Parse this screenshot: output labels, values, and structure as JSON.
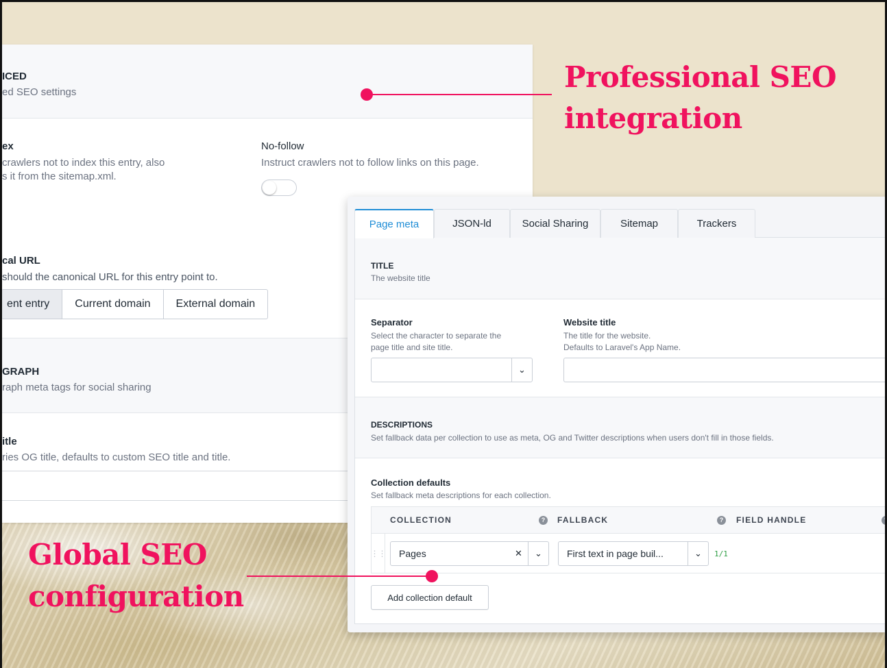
{
  "callouts": {
    "professional_line1": "Professional SEO",
    "professional_line2": "integration",
    "global_line1": "Global SEO",
    "global_line2": "configuration"
  },
  "back_panel": {
    "advanced_title": "ICED",
    "advanced_subtitle": "ed SEO settings",
    "noindex_label": "ex",
    "noindex_desc_line1": "crawlers not to index this entry, also",
    "noindex_desc_line2": "s it from the sitemap.xml.",
    "nofollow_label": "No-follow",
    "nofollow_desc": "Instruct crawlers not to follow links on this page.",
    "canonical_label": "cal URL",
    "canonical_desc": "should the canonical URL for this entry point to.",
    "canonical_options": [
      "ent entry",
      "Current domain",
      "External domain"
    ],
    "og_title": "GRAPH",
    "og_subtitle": "raph meta tags for social sharing",
    "og_title_label": "itle",
    "og_title_desc": "ries OG title, defaults to custom SEO title and title."
  },
  "front_panel": {
    "tabs": [
      "Page meta",
      "JSON-ld",
      "Social Sharing",
      "Sitemap",
      "Trackers"
    ],
    "title_section": {
      "heading": "TITLE",
      "sub": "The website title"
    },
    "separator": {
      "label": "Separator",
      "desc_line1": "Select the character to separate the",
      "desc_line2": "page title and site title."
    },
    "website_title": {
      "label": "Website title",
      "desc_line1": "The title for the website.",
      "desc_line2": "Defaults to Laravel's App Name."
    },
    "descriptions_section": {
      "heading": "DESCRIPTIONS",
      "sub": "Set fallback data per collection to use as meta, OG and Twitter descriptions when users don't fill in those fields."
    },
    "collection_defaults": {
      "label": "Collection defaults",
      "desc": "Set fallback meta descriptions for each collection.",
      "columns": [
        "COLLECTION",
        "FALLBACK",
        "FIELD HANDLE"
      ],
      "row": {
        "collection": "Pages",
        "fallback": "First text in page buil...",
        "counter": "1/1"
      },
      "add_button": "Add collection default"
    }
  },
  "colors": {
    "accent_pink": "#f0125e",
    "tab_active_blue": "#1f8dd6",
    "background_cream": "#ece3cc"
  }
}
